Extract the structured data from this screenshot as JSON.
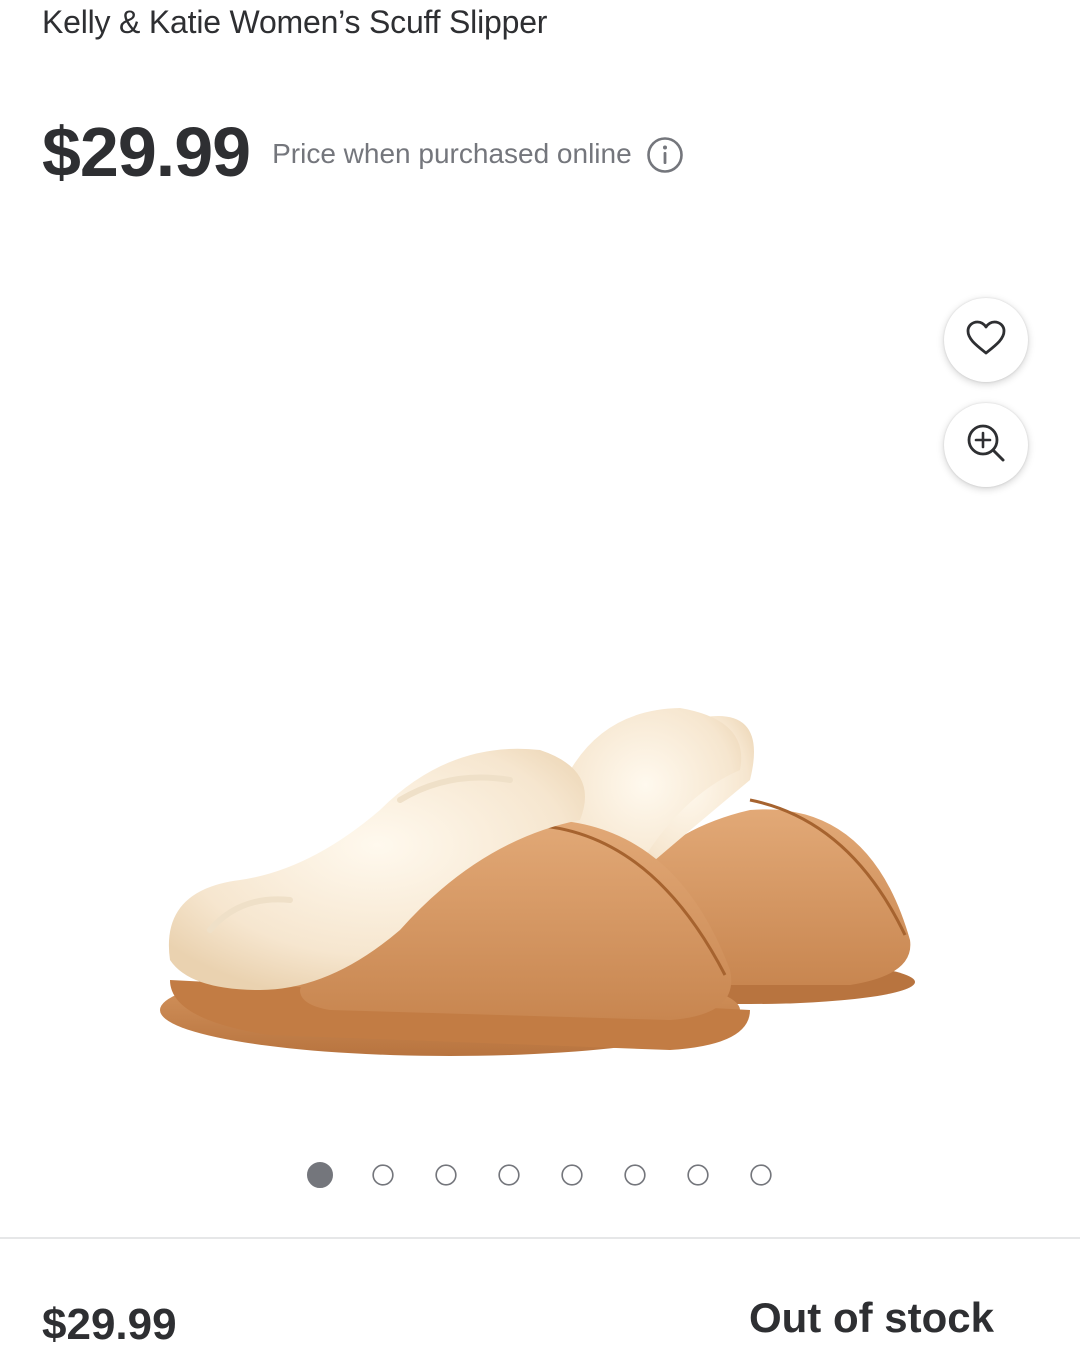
{
  "product": {
    "title": "Kelly & Katie Women’s Scuff Slipper",
    "price": "$29.99",
    "price_note": "Price when purchased online"
  },
  "icons": {
    "info": "info-icon",
    "favorite": "heart-icon",
    "zoom": "zoom-in-icon"
  },
  "gallery": {
    "total_images": 8,
    "active_index": 1,
    "image_subject": "tan suede scuff slippers with cream faux fur lining"
  },
  "footer": {
    "price": "$29.99",
    "stock_status": "Out of stock"
  },
  "colors": {
    "text": "#2e2f32",
    "muted": "#74767c"
  }
}
